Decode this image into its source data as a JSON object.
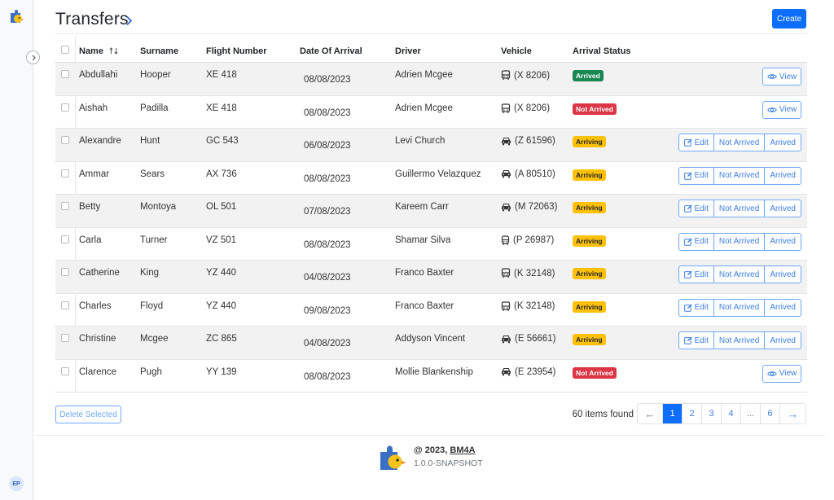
{
  "app": {
    "footer_year_text": "@ 2023,",
    "footer_brand": "BM4A",
    "footer_version": "1.0.0-SNAPSHOT"
  },
  "user": {
    "initials": "EP"
  },
  "header": {
    "title": "Transfers",
    "create_label": "Create"
  },
  "table": {
    "columns": {
      "name": "Name",
      "surname": "Surname",
      "flight": "Flight Number",
      "date": "Date Of Arrival",
      "driver": "Driver",
      "vehicle": "Vehicle",
      "status": "Arrival Status"
    },
    "actions": {
      "view": "View",
      "edit": "Edit",
      "not_arrived": "Not Arrived",
      "arrived": "Arrived"
    },
    "rows": [
      {
        "name": "Abdullahi",
        "surname": "Hooper",
        "flight": "XE 418",
        "date": "08/08/2023",
        "driver": "Adrien Mcgee",
        "vehicle": "(X 8206)",
        "vehicle_icon": "bus-icon",
        "status": "Arrived",
        "status_kind": "arrived"
      },
      {
        "name": "Aishah",
        "surname": "Padilla",
        "flight": "XE 418",
        "date": "08/08/2023",
        "driver": "Adrien Mcgee",
        "vehicle": "(X 8206)",
        "vehicle_icon": "bus-icon",
        "status": "Not Arrived",
        "status_kind": "notarrived"
      },
      {
        "name": "Alexandre",
        "surname": "Hunt",
        "flight": "GC 543",
        "date": "06/08/2023",
        "driver": "Levi Church",
        "vehicle": "(Z 61596)",
        "vehicle_icon": "car-icon",
        "status": "Arriving",
        "status_kind": "arriving"
      },
      {
        "name": "Ammar",
        "surname": "Sears",
        "flight": "AX 736",
        "date": "08/08/2023",
        "driver": "Guillermo Velazquez",
        "vehicle": "(A 80510)",
        "vehicle_icon": "car-icon",
        "status": "Arriving",
        "status_kind": "arriving"
      },
      {
        "name": "Betty",
        "surname": "Montoya",
        "flight": "OL 501",
        "date": "07/08/2023",
        "driver": "Kareem Carr",
        "vehicle": "(M 72063)",
        "vehicle_icon": "car-icon",
        "status": "Arriving",
        "status_kind": "arriving"
      },
      {
        "name": "Carla",
        "surname": "Turner",
        "flight": "VZ 501",
        "date": "08/08/2023",
        "driver": "Shamar Silva",
        "vehicle": "(P 26987)",
        "vehicle_icon": "van-icon",
        "status": "Arriving",
        "status_kind": "arriving"
      },
      {
        "name": "Catherine",
        "surname": "King",
        "flight": "YZ 440",
        "date": "04/08/2023",
        "driver": "Franco Baxter",
        "vehicle": "(K 32148)",
        "vehicle_icon": "bus-icon",
        "status": "Arriving",
        "status_kind": "arriving"
      },
      {
        "name": "Charles",
        "surname": "Floyd",
        "flight": "YZ 440",
        "date": "09/08/2023",
        "driver": "Franco Baxter",
        "vehicle": "(K 32148)",
        "vehicle_icon": "bus-icon",
        "status": "Arriving",
        "status_kind": "arriving"
      },
      {
        "name": "Christine",
        "surname": "Mcgee",
        "flight": "ZC 865",
        "date": "04/08/2023",
        "driver": "Addyson Vincent",
        "vehicle": "(E 56661)",
        "vehicle_icon": "car-icon",
        "status": "Arriving",
        "status_kind": "arriving"
      },
      {
        "name": "Clarence",
        "surname": "Pugh",
        "flight": "YY 139",
        "date": "08/08/2023",
        "driver": "Mollie Blankenship",
        "vehicle": "(E 23954)",
        "vehicle_icon": "car-icon",
        "status": "Not Arrived",
        "status_kind": "notarrived"
      }
    ]
  },
  "bulk": {
    "delete_label": "Delete Selected"
  },
  "pagination": {
    "items_found": "60 items found",
    "prev": "←",
    "next": "→",
    "pages": [
      "1",
      "2",
      "3",
      "4",
      "...",
      "6"
    ],
    "active_page": "1"
  },
  "colors": {
    "primary": "#0d6efd",
    "success": "#198754",
    "danger": "#dc3545",
    "warning": "#ffc107"
  }
}
